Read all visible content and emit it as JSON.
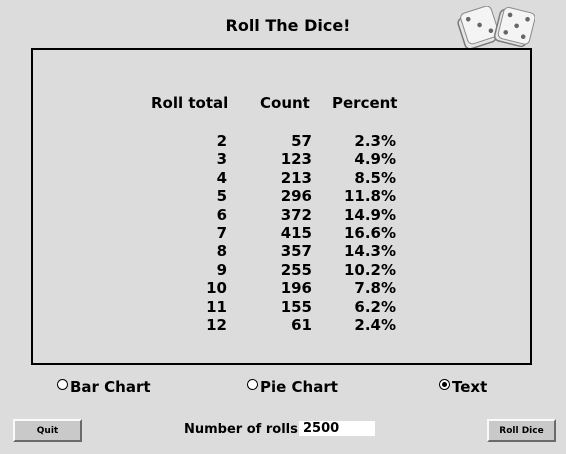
{
  "window": {
    "title": "Roll The Dice!"
  },
  "dice_icon": {
    "name": "dice-icon"
  },
  "table": {
    "headers": {
      "roll_total": "Roll total",
      "count": "Count",
      "percent": "Percent"
    },
    "rows": [
      {
        "roll_total": "2",
        "count": "57",
        "percent": "2.3%"
      },
      {
        "roll_total": "3",
        "count": "123",
        "percent": "4.9%"
      },
      {
        "roll_total": "4",
        "count": "213",
        "percent": "8.5%"
      },
      {
        "roll_total": "5",
        "count": "296",
        "percent": "11.8%"
      },
      {
        "roll_total": "6",
        "count": "372",
        "percent": "14.9%"
      },
      {
        "roll_total": "7",
        "count": "415",
        "percent": "16.6%"
      },
      {
        "roll_total": "8",
        "count": "357",
        "percent": "14.3%"
      },
      {
        "roll_total": "9",
        "count": "255",
        "percent": "10.2%"
      },
      {
        "roll_total": "10",
        "count": "196",
        "percent": "7.8%"
      },
      {
        "roll_total": "11",
        "count": "155",
        "percent": "6.2%"
      },
      {
        "roll_total": "12",
        "count": "61",
        "percent": "2.4%"
      }
    ]
  },
  "view_options": [
    {
      "label": "Bar Chart",
      "selected": false
    },
    {
      "label": "Pie Chart",
      "selected": false
    },
    {
      "label": "Text",
      "selected": true
    }
  ],
  "controls": {
    "quit_label": "Quit",
    "rolls_label": "Number of rolls:",
    "rolls_value": "2500",
    "roll_label": "Roll Dice"
  }
}
